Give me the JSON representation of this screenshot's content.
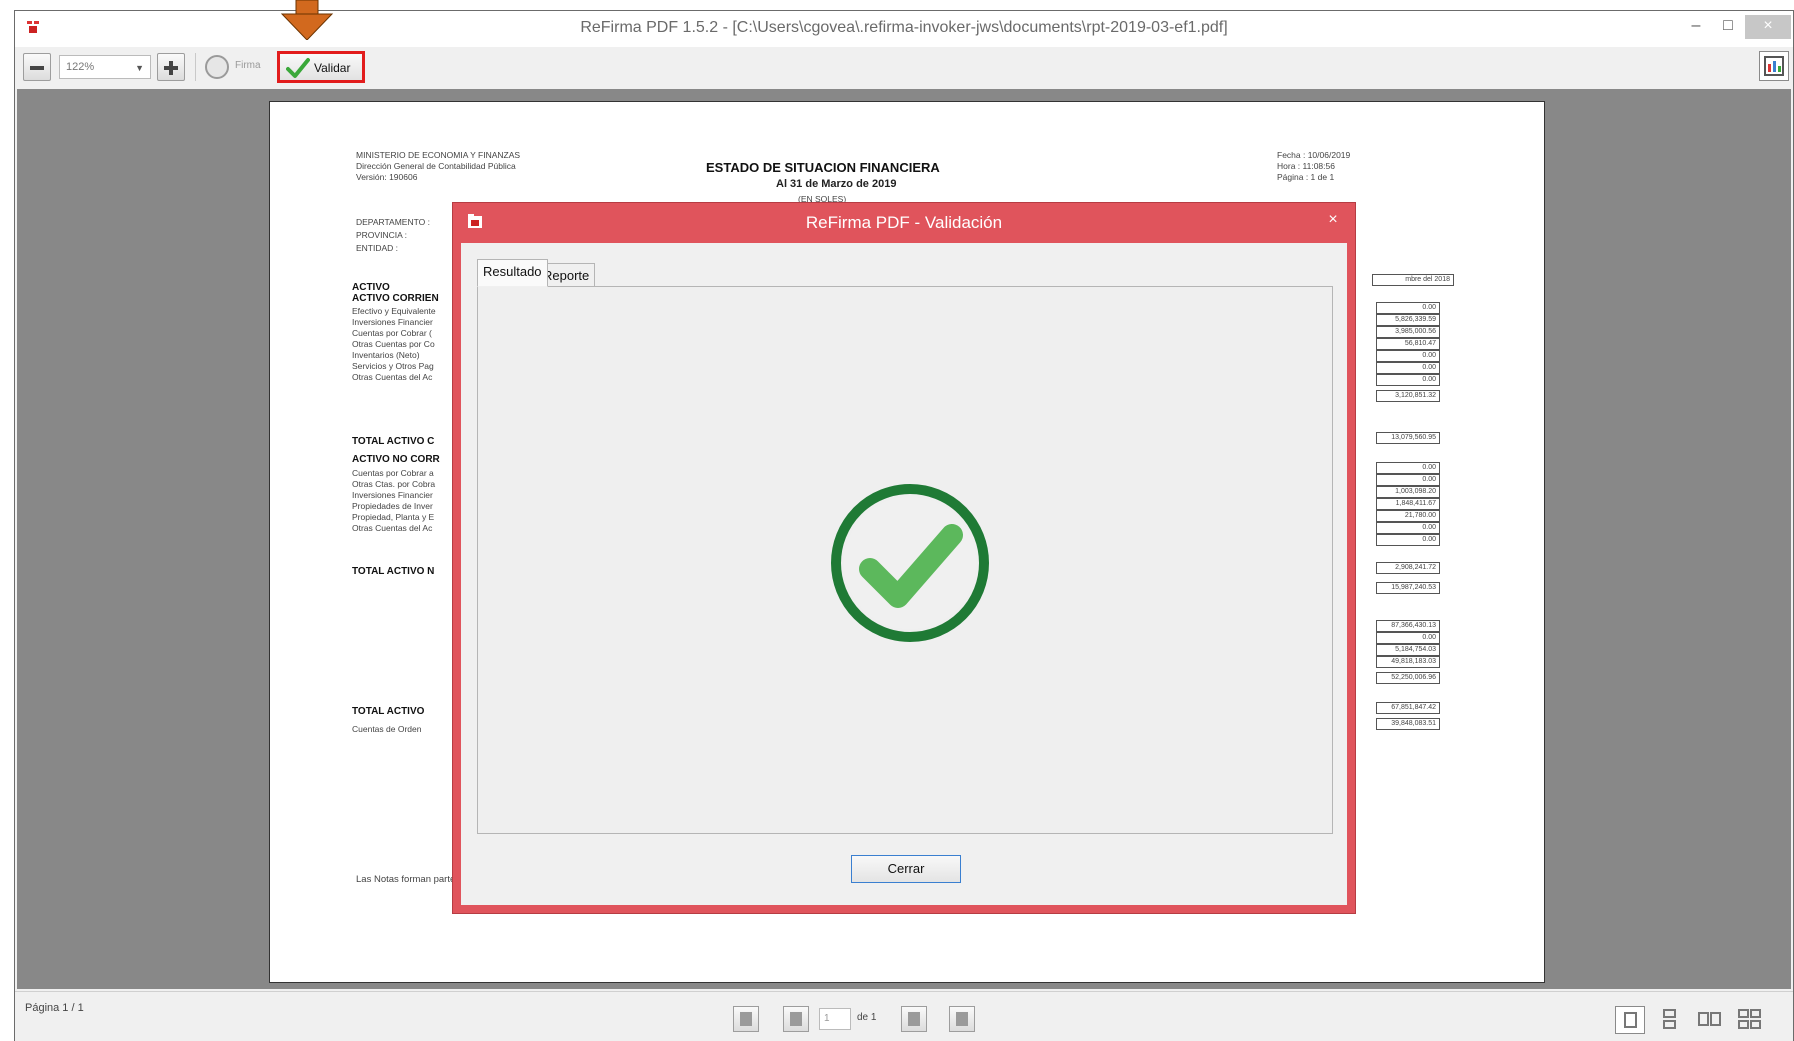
{
  "window": {
    "title": "ReFirma PDF 1.5.2 - [C:\\Users\\cgovea\\.refirma-invoker-jws\\documents\\rpt-2019-03-ef1.pdf]",
    "controls": {
      "minimize": "–",
      "maximize": "□",
      "close": "×"
    }
  },
  "toolbar": {
    "zoom_value": "122%",
    "firma_label": "Firma",
    "validar_label": "Validar"
  },
  "document": {
    "header_left": [
      "MINISTERIO DE ECONOMIA Y FINANZAS",
      "Dirección General de Contabilidad Pública",
      "Versión: 190606"
    ],
    "title": "ESTADO DE SITUACION FINANCIERA",
    "subtitle": "Al 31 de Marzo de 2019",
    "currency": "(EN SOLES)",
    "header_right": [
      "Fecha : 10/06/2019",
      "Hora : 11:08:56",
      "Página : 1 de 1"
    ],
    "info_labels": [
      "DEPARTAMENTO :",
      "PROVINCIA :",
      "ENTIDAD :"
    ],
    "sections": {
      "activo": "ACTIVO",
      "activo_corriente": "ACTIVO CORRIEN",
      "total_activo_corriente": "TOTAL ACTIVO C",
      "activo_no_corriente": "ACTIVO NO CORR",
      "total_activo_no_corriente": "TOTAL ACTIVO N",
      "total_activo": "TOTAL ACTIVO",
      "cuentas_orden": "Cuentas de Orden"
    },
    "corriente_items": [
      "Efectivo y Equivalente",
      "Inversiones Financier",
      "Cuentas por Cobrar (",
      "Otras Cuentas por Co",
      "Inventarios (Neto)",
      "Servicios y Otros Pag",
      "Otras Cuentas del Ac"
    ],
    "no_corriente_items": [
      "Cuentas por Cobrar a",
      "Otras Ctas. por Cobra",
      "Inversiones Financier",
      "Propiedades de Inver",
      "Propiedad, Planta y E",
      "Otras Cuentas del Ac"
    ],
    "column_header": "mbre del 2018",
    "values_corriente": [
      "0.00",
      "5,826,339.59",
      "3,985,000.56",
      "56,810.47",
      "0.00",
      "0.00",
      "0.00",
      "3,120,851.32"
    ],
    "value_total_corriente": "13,079,560.95",
    "values_no_corriente": [
      "0.00",
      "0.00",
      "1,003,098.20",
      "1,848,411.67",
      "21,780.00",
      "0.00",
      "0.00"
    ],
    "value_total_no_corriente": "2,908,241.72",
    "value_extra": "15,987,240.53",
    "values_lower": [
      "87,366,430.13",
      "0.00",
      "5,184,754.03",
      "49,818,183.03",
      "52,250,006.96"
    ],
    "value_total_activo": "67,851,847.42",
    "value_cuentas_orden": "39,848,083.51",
    "footer": "Las Notas forman parte integrante de los Estados Financieros"
  },
  "dialog": {
    "title": "ReFirma PDF - Validación",
    "close": "×",
    "tabs": [
      {
        "label": "Resultado"
      },
      {
        "label": "Reporte"
      }
    ],
    "result_icon": "check-circle-icon",
    "result_color": "#5cb85c",
    "ring_color": "#1f7a35",
    "close_button": "Cerrar"
  },
  "statusbar": {
    "page_status": "Página 1 / 1",
    "page_input": "1",
    "page_of": "de 1"
  },
  "colors": {
    "dialog_frame": "#e0545c",
    "highlight": "#e21c1c",
    "arrow": "#d2691e",
    "viewer_bg": "#888888"
  }
}
